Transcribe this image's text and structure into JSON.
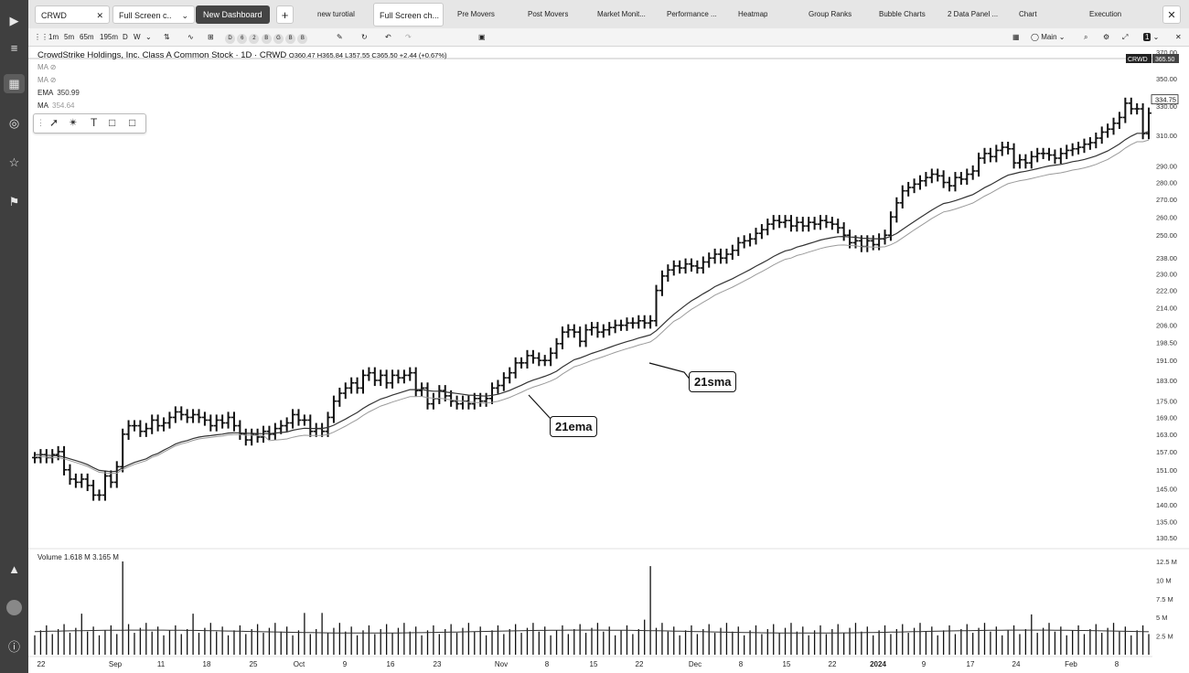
{
  "topbar": {
    "symbol": "CRWD",
    "tabs": [
      "Full Screen c..",
      "New Dashboard",
      "new turotial",
      "Full Screen ch...",
      "Pre Movers",
      "Post Movers",
      "Market Monit...",
      "Performance ...",
      "Heatmap",
      "Group Ranks",
      "Bubble Charts",
      "2 Data Panel ...",
      "Chart",
      "Execution"
    ]
  },
  "toolbar": {
    "timeframes": [
      "1m",
      "5m",
      "65m",
      "195m",
      "D",
      "W"
    ],
    "circles": [
      "D",
      "6",
      "2",
      "B",
      "G",
      "B",
      "B"
    ],
    "layout_label": "Main",
    "count": "1"
  },
  "chart_header": {
    "title": "CrowdStrike Holdings, Inc. Class A Common Stock · 1D · CRWD",
    "ohlc": "O360.47  H365.84  L357.55  C365.50  +2.44 (+0.67%)",
    "symbol_tag": "CRWD",
    "symbol_price": "365.50"
  },
  "indicators": [
    {
      "label": "MA",
      "value": ""
    },
    {
      "label": "MA",
      "value": ""
    },
    {
      "label": "EMA",
      "value": "350.99"
    },
    {
      "label": "MA",
      "value": "354.64"
    }
  ],
  "volume_header": {
    "label": "Volume",
    "v1": "1.618 M",
    "v2": "3.165 M"
  },
  "annotations": {
    "sma": "21sma",
    "ema": "21ema"
  },
  "colors": {
    "bars": "#111111",
    "ema": "#333333",
    "sma": "#9a9a9a"
  },
  "chart_data": {
    "type": "bar",
    "scale": "log",
    "ylim": [
      128,
      370
    ],
    "yticks": [
      370,
      350,
      330,
      310,
      290,
      280,
      270,
      260,
      250,
      238,
      230,
      222,
      214,
      206,
      198.5,
      191,
      183,
      175,
      169,
      163,
      157,
      151,
      145,
      140,
      135,
      130.5
    ],
    "ytick_labels": [
      "370.00",
      "350.00",
      "330.00",
      "310.00",
      "290.00",
      "280.00",
      "270.00",
      "260.00",
      "250.00",
      "238.00",
      "230.00",
      "222.00",
      "214.00",
      "206.00",
      "198.50",
      "191.00",
      "183.00",
      "175.00",
      "169.00",
      "163.00",
      "157.00",
      "151.00",
      "145.00",
      "140.00",
      "135.00",
      "130.50"
    ],
    "price_flag": "334.75",
    "x_labels": [
      "22",
      "Sep",
      "11",
      "18",
      "25",
      "Oct",
      "9",
      "16",
      "23",
      "Nov",
      "8",
      "15",
      "22",
      "Dec",
      "8",
      "15",
      "22",
      "2024",
      "9",
      "17",
      "24",
      "Feb",
      "8"
    ],
    "close": [
      155,
      156,
      155,
      156,
      157,
      151,
      148,
      147,
      148,
      146,
      143,
      143,
      149,
      147,
      152,
      163,
      166,
      166,
      164,
      165,
      168,
      166,
      167,
      169,
      171,
      170,
      169,
      170,
      169,
      168,
      166,
      168,
      167,
      169,
      166,
      163,
      161,
      163,
      162,
      164,
      163,
      165,
      166,
      167,
      170,
      168,
      168,
      164,
      165,
      164,
      169,
      175,
      178,
      180,
      182,
      180,
      185,
      186,
      183,
      185,
      182,
      185,
      184,
      185,
      186,
      179,
      180,
      174,
      176,
      179,
      177,
      175,
      174,
      175,
      174,
      176,
      175,
      176,
      180,
      181,
      184,
      186,
      190,
      190,
      193,
      192,
      191,
      191,
      194,
      198,
      203,
      204,
      203,
      199,
      204,
      205,
      203,
      204,
      205,
      206,
      206,
      207,
      207,
      208,
      207,
      208,
      222,
      229,
      232,
      234,
      233,
      235,
      234,
      233,
      236,
      238,
      240,
      238,
      240,
      242,
      246,
      247,
      248,
      251,
      253,
      256,
      258,
      257,
      258,
      255,
      257,
      255,
      257,
      256,
      258,
      257,
      256,
      254,
      250,
      246,
      247,
      244,
      247,
      245,
      248,
      250,
      260,
      268,
      275,
      277,
      279,
      281,
      283,
      285,
      284,
      280,
      278,
      283,
      282,
      285,
      287,
      295,
      298,
      296,
      300,
      302,
      301,
      292,
      294,
      292,
      296,
      298,
      298,
      297,
      295,
      298,
      300,
      301,
      302,
      304,
      305,
      308,
      312,
      314,
      318,
      322,
      332,
      328,
      328,
      311,
      325
    ],
    "ema21": [
      156,
      156,
      155.8,
      155.7,
      155.6,
      155.2,
      154.6,
      154,
      153.4,
      152.7,
      151.7,
      150.8,
      150.6,
      150.4,
      150.5,
      151.7,
      152.6,
      153.4,
      154,
      154.6,
      155.7,
      156.4,
      157.5,
      158.5,
      159.6,
      160.3,
      160.8,
      161.5,
      162,
      162.3,
      162.5,
      162.8,
      163,
      163.4,
      163.5,
      163.5,
      163.3,
      163.3,
      163.2,
      163.2,
      163.2,
      163.4,
      163.6,
      163.8,
      164.4,
      164.8,
      165.1,
      165,
      165,
      165,
      165.4,
      166.2,
      167.3,
      168.4,
      169.6,
      170.8,
      172.3,
      173.6,
      174.7,
      175.8,
      176.5,
      177.3,
      178,
      178.7,
      179.4,
      179.4,
      179.5,
      179,
      178.8,
      178.8,
      178.5,
      178.2,
      177.9,
      177.6,
      177.3,
      177.2,
      177,
      176.9,
      177.2,
      177.6,
      178.3,
      179.1,
      180.1,
      181.1,
      182.2,
      183.1,
      183.8,
      184.6,
      185.5,
      186.6,
      188.3,
      189.8,
      191.3,
      192,
      192.9,
      193.9,
      194.7,
      195.5,
      196.4,
      197.3,
      198.1,
      198.9,
      199.6,
      200.4,
      201.1,
      201.8,
      203.6,
      206,
      208.5,
      210.9,
      213,
      215.1,
      217.1,
      218.7,
      220.4,
      222,
      223.8,
      225.1,
      226.4,
      227.7,
      229.2,
      230.7,
      232.2,
      233.9,
      235.4,
      237,
      238.8,
      240.3,
      241.7,
      242.4,
      243.7,
      244.5,
      245.5,
      246.4,
      247.4,
      248.1,
      248.7,
      249.2,
      249.3,
      249,
      248.9,
      248.4,
      248.3,
      248.1,
      248.1,
      248.3,
      249.4,
      250.9,
      253.1,
      255.3,
      257.5,
      259.6,
      261.7,
      263.9,
      265.8,
      267.6,
      268.3,
      269.3,
      270.4,
      271.6,
      272.8,
      274.8,
      276.9,
      278.6,
      280.6,
      282.6,
      284.4,
      285.3,
      286.2,
      286.8,
      287.6,
      288.4,
      289.3,
      290.1,
      290.6,
      291.1,
      291.9,
      292.8,
      293.4,
      294.2,
      295.2,
      296.4,
      298,
      299.6,
      301.8,
      304.1,
      307,
      309.3,
      311.2,
      311.2,
      312.4
    ]
  }
}
